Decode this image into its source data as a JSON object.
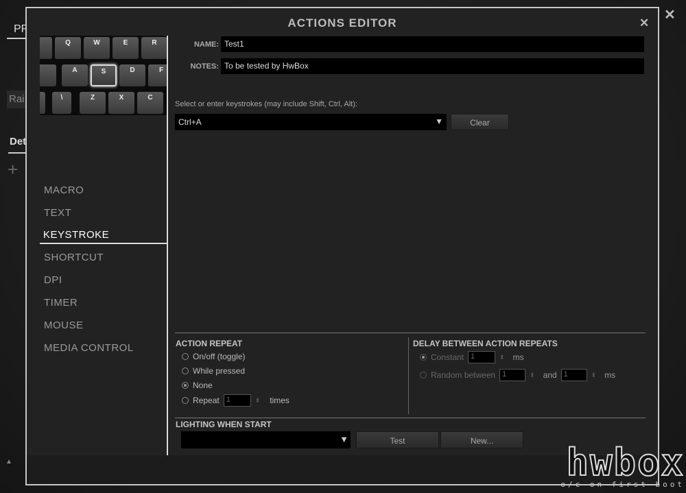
{
  "background": {
    "tab_fragment": "PR",
    "dropdown_fragment": "Rai",
    "section_fragment": "Det",
    "add_icon": "plus-icon",
    "close_icon": "close-icon",
    "scroll_up_icon": "triangle-up-icon"
  },
  "dialog": {
    "title": "ACTIONS EDITOR",
    "close_icon": "close-icon"
  },
  "keyboard": {
    "keys": [
      "Q",
      "W",
      "E",
      "R",
      "A",
      "S",
      "D",
      "F",
      "\\",
      "Z",
      "X",
      "C"
    ],
    "selected_key": "S"
  },
  "menu": {
    "items": [
      "MACRO",
      "TEXT",
      "KEYSTROKE",
      "SHORTCUT",
      "DPI",
      "TIMER",
      "MOUSE",
      "MEDIA CONTROL"
    ],
    "active": "KEYSTROKE"
  },
  "form": {
    "name_label": "NAME:",
    "name_value": "Test1",
    "notes_label": "NOTES:",
    "notes_value": "To be tested by HwBox",
    "keystroke_prompt": "Select or enter keystrokes (may include Shift, Ctrl, Alt):",
    "keystroke_value": "Ctrl+A",
    "clear_label": "Clear"
  },
  "action_repeat": {
    "title": "ACTION REPEAT",
    "options": [
      "On/off (toggle)",
      "While pressed",
      "None",
      "Repeat"
    ],
    "selected": "None",
    "repeat_value": "1",
    "times_label": "times"
  },
  "delay": {
    "title": "DELAY BETWEEN ACTION REPEATS",
    "constant_label": "Constant",
    "constant_value": "1",
    "ms": "ms",
    "random_label": "Random between",
    "random_from": "1",
    "and_label": "and",
    "random_to": "1"
  },
  "lighting": {
    "title": "LIGHTING WHEN START",
    "value": "",
    "test_label": "Test",
    "new_label": "New..."
  },
  "watermark": {
    "logo": "hwbox",
    "tagline": "o/c on first boot"
  }
}
